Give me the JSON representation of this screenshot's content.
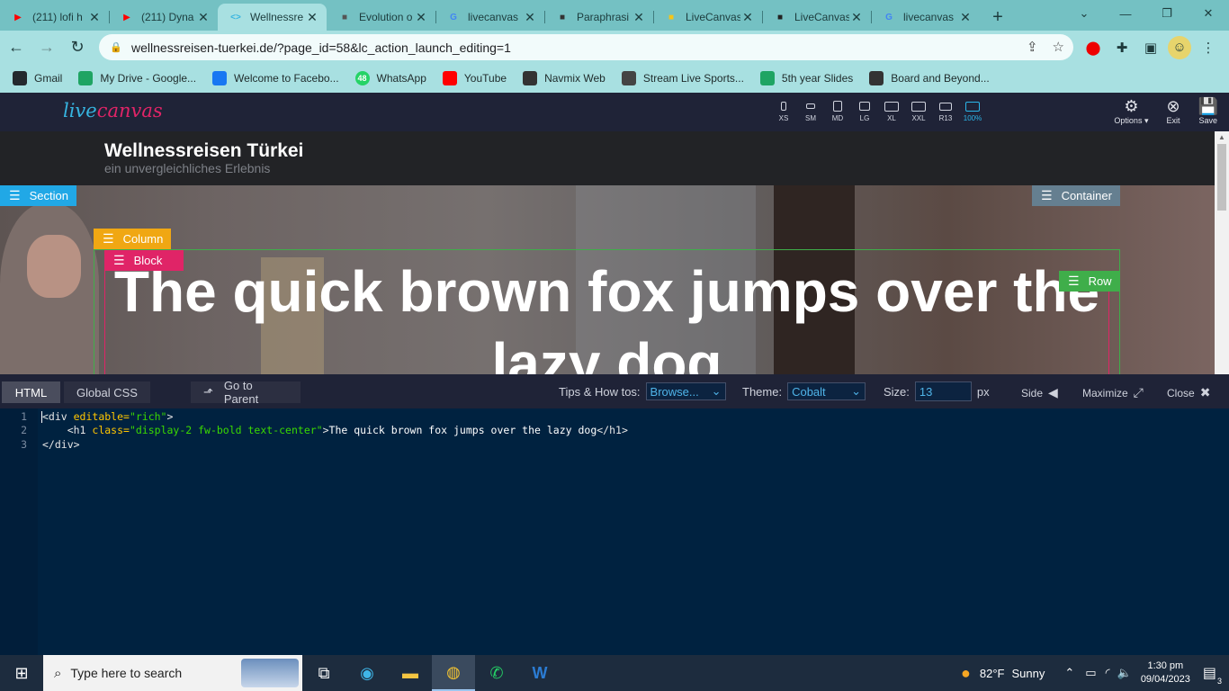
{
  "browser": {
    "tabs": [
      {
        "title": "(211) lofi h",
        "icon": "youtube-icon",
        "color": "#ff0000",
        "active": false
      },
      {
        "title": "(211) Dyna",
        "icon": "youtube-icon",
        "color": "#ff0000",
        "active": false
      },
      {
        "title": "Wellnessre",
        "icon": "code-icon",
        "color": "#36b4e0",
        "active": true
      },
      {
        "title": "Evolution o",
        "icon": "chatgpt-icon",
        "color": "#555555",
        "active": false
      },
      {
        "title": "livecanvas",
        "icon": "google-icon",
        "color": "#4285f4",
        "active": false
      },
      {
        "title": "Paraphrasi",
        "icon": "quill-icon",
        "color": "#333333",
        "active": false
      },
      {
        "title": "LiveCanvas",
        "icon": "livecanvas-icon",
        "color": "#f5c518",
        "active": false
      },
      {
        "title": "LiveCanvas",
        "icon": "livecanvas-dark-icon",
        "color": "#222222",
        "active": false
      },
      {
        "title": "livecanvas",
        "icon": "google-icon",
        "color": "#4285f4",
        "active": false
      }
    ],
    "url": "wellnessreisen-tuerkei.de/?page_id=58&lc_action_launch_editing=1",
    "bookmarks": [
      {
        "label": "Gmail",
        "icon": "github-icon",
        "color": "#24292e"
      },
      {
        "label": "My Drive - Google...",
        "icon": "drive-icon",
        "color": "#1fa463"
      },
      {
        "label": "Welcome to Facebo...",
        "icon": "facebook-icon",
        "color": "#1877f2"
      },
      {
        "label": "WhatsApp",
        "icon": "whatsapp-icon",
        "color": "#25d366",
        "badge": "48"
      },
      {
        "label": "YouTube",
        "icon": "youtube-icon",
        "color": "#ff0000"
      },
      {
        "label": "Navmix Web",
        "icon": "navmix-icon",
        "color": "#333333"
      },
      {
        "label": "Stream Live Sports...",
        "icon": "soccer-icon",
        "color": "#444444"
      },
      {
        "label": "5th year Slides",
        "icon": "drive-icon",
        "color": "#1fa463"
      },
      {
        "label": "Board and Beyond...",
        "icon": "board-icon",
        "color": "#333333"
      }
    ]
  },
  "livecanvas": {
    "logo_live": "live",
    "logo_canvas": "canvas",
    "devices": [
      "XS",
      "SM",
      "MD",
      "LG",
      "XL",
      "XXL",
      "R13",
      "100%"
    ],
    "active_device": "100%",
    "actions": {
      "options": "Options",
      "exit": "Exit",
      "save": "Save"
    }
  },
  "site": {
    "title": "Wellnessreisen Türkei",
    "subtitle": "ein unvergleichliches Erlebnis",
    "headline": "The quick brown fox jumps over the lazy dog",
    "labels": {
      "section": "Section",
      "container": "Container",
      "column": "Column",
      "block": "Block",
      "row": "Row"
    }
  },
  "editor": {
    "tab_html": "HTML",
    "tab_css": "Global CSS",
    "go_parent": "Go to Parent",
    "tips_label": "Tips & How tos:",
    "tips_value": "Browse...",
    "theme_label": "Theme:",
    "theme_value": "Cobalt",
    "size_label": "Size:",
    "size_value": "13",
    "size_unit": "px",
    "side": "Side",
    "maximize": "Maximize",
    "close": "Close",
    "code_lines": [
      {
        "n": "1",
        "indent": "",
        "tag_open": "<div ",
        "attr": "editable=",
        "str": "\"rich\"",
        "tag_close": ">",
        "text": "",
        "end": ""
      },
      {
        "n": "2",
        "indent": "    ",
        "tag_open": "<h1 ",
        "attr": "class=",
        "str": "\"display-2 fw-bold text-center\"",
        "tag_close": ">",
        "text": "The quick brown fox jumps over the lazy dog",
        "end": "</h1>"
      },
      {
        "n": "3",
        "indent": "",
        "tag_open": "</div>",
        "attr": "",
        "str": "",
        "tag_close": "",
        "text": "",
        "end": ""
      }
    ]
  },
  "taskbar": {
    "search_placeholder": "Type here to search",
    "weather_temp": "82°F",
    "weather_text": "Sunny",
    "time": "1:30 pm",
    "date": "09/04/2023",
    "notifications": "3"
  }
}
